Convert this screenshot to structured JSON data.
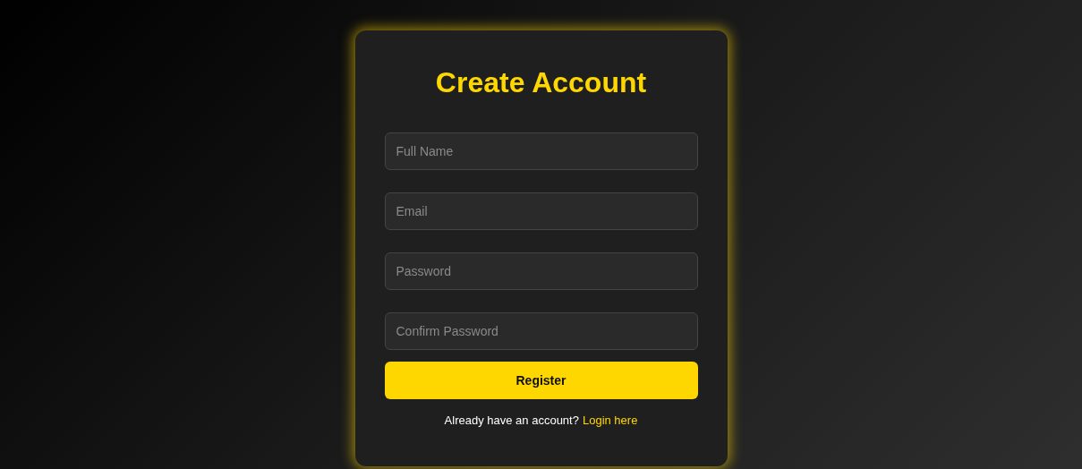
{
  "title": "Create Account",
  "fields": [
    {
      "placeholder": "Full Name"
    },
    {
      "placeholder": "Email"
    },
    {
      "placeholder": "Password"
    },
    {
      "placeholder": "Confirm Password"
    }
  ],
  "button": "Register",
  "footer": {
    "text": "Already have an account?",
    "link": "Login here"
  }
}
